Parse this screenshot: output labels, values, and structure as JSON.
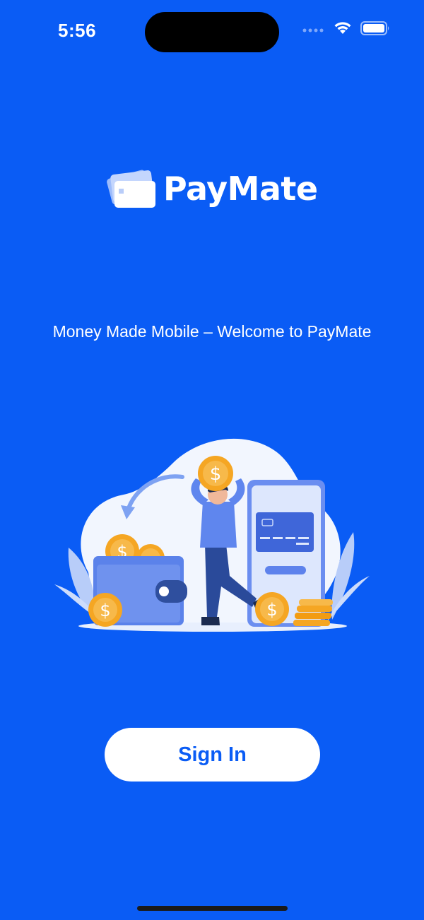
{
  "status_bar": {
    "time": "5:56",
    "icons": [
      "signal-dots-icon",
      "wifi-icon",
      "battery-icon"
    ]
  },
  "app": {
    "name": "PayMate",
    "logo_icon": "cards-icon"
  },
  "tagline": "Money Made Mobile – Welcome to PayMate",
  "illustration": {
    "icons": [
      "wallet-icon",
      "coin-icon",
      "phone-card-icon",
      "person-icon",
      "coin-stack-icon",
      "leaf-icon",
      "arrow-icon"
    ]
  },
  "actions": {
    "sign_in_label": "Sign In"
  },
  "colors": {
    "background": "#0a5cf5",
    "button_bg": "#ffffff",
    "button_text": "#0a5cf5",
    "coin": "#f5a623"
  }
}
